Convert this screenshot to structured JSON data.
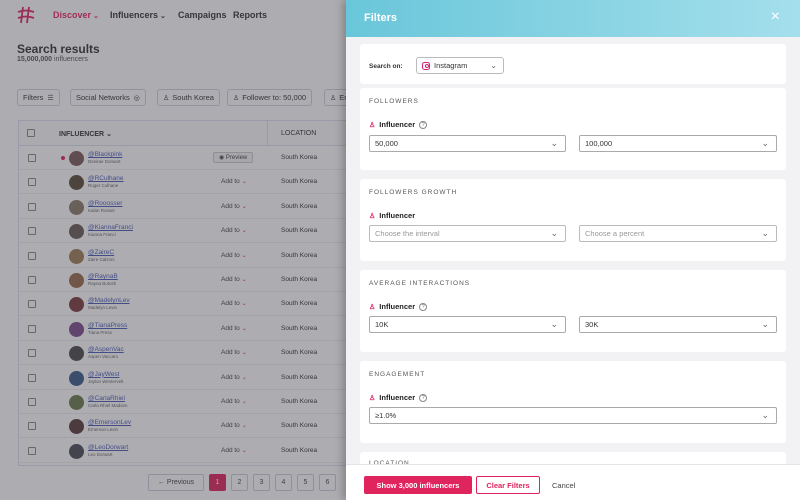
{
  "nav": {
    "items": [
      {
        "label": "Discover",
        "caret": "⌄",
        "active": true
      },
      {
        "label": "Influencers",
        "caret": "⌄",
        "active": false
      },
      {
        "label": "Campaigns",
        "caret": "",
        "active": false
      },
      {
        "label": "Reports",
        "caret": "",
        "active": false
      }
    ]
  },
  "page": {
    "title": "Search results",
    "count": "15,000,000",
    "count_suffix": "influencers"
  },
  "filter_chips": [
    {
      "label": "Filters",
      "icon": "sliders-icon"
    },
    {
      "label": "Social Networks",
      "icon": "instagram-icon"
    },
    {
      "label": "South Korea",
      "icon": "person-icon"
    },
    {
      "label": "Follower to: 50,000",
      "icon": "person-icon"
    },
    {
      "label": "En",
      "icon": "person-icon"
    }
  ],
  "table": {
    "headers": {
      "influencer": "INFLUENCER",
      "location": "LOCATION"
    },
    "preview_label": "Preview",
    "add_label": "Add to",
    "rows": [
      {
        "handle": "@Blackpink",
        "name": "Desirae Dorwart",
        "location": "South Korea",
        "action": "preview",
        "avatar_color": "#7a5a5a"
      },
      {
        "handle": "@RCulhane",
        "name": "Roger Culhane",
        "location": "South Korea",
        "action": "add",
        "avatar_color": "#5a4a3a"
      },
      {
        "handle": "@Rooosser",
        "name": "Kalan Rosser",
        "location": "South Korea",
        "action": "add",
        "avatar_color": "#8a7a6a"
      },
      {
        "handle": "@KiannaFranci",
        "name": "Kianna Franci",
        "location": "South Korea",
        "action": "add",
        "avatar_color": "#6a5a55"
      },
      {
        "handle": "@ZaireC",
        "name": "Zaire Calzoni",
        "location": "South Korea",
        "action": "add",
        "avatar_color": "#a07a55"
      },
      {
        "handle": "@RaynaB",
        "name": "Rayna Botosh",
        "location": "South Korea",
        "action": "add",
        "avatar_color": "#9a6a4a"
      },
      {
        "handle": "@MadelynLev",
        "name": "Madelyn Levin",
        "location": "South Korea",
        "action": "add",
        "avatar_color": "#7a3a3a"
      },
      {
        "handle": "@TianaPress",
        "name": "Tiana Press",
        "location": "South Korea",
        "action": "add",
        "avatar_color": "#7a4a8a"
      },
      {
        "handle": "@AspenVac",
        "name": "Aspen Vaccaro",
        "location": "South Korea",
        "action": "add",
        "avatar_color": "#4a4a4a"
      },
      {
        "handle": "@JayWest",
        "name": "Jaylon Westervelt",
        "location": "South Korea",
        "action": "add",
        "avatar_color": "#3a5a8a"
      },
      {
        "handle": "@CarlaRhiel",
        "name": "Carla Rhiel Madsen",
        "location": "South Korea",
        "action": "add",
        "avatar_color": "#6a7a4a"
      },
      {
        "handle": "@EmersonLev",
        "name": "Emerson Levin",
        "location": "South Korea",
        "action": "add",
        "avatar_color": "#5a3a3a"
      },
      {
        "handle": "@LeoDorwart",
        "name": "Leo Dorwart",
        "location": "South Korea",
        "action": "add",
        "avatar_color": "#4a4a55"
      }
    ]
  },
  "pagination": {
    "previous": "← Previous",
    "pages": [
      "1",
      "2",
      "3",
      "4",
      "5",
      "6"
    ],
    "current": "1"
  },
  "drawer": {
    "title": "Filters",
    "close_icon": "×",
    "search_on": {
      "label": "Search on:",
      "value": "Instagram",
      "icon": "instagram-icon"
    },
    "sections": [
      {
        "title": "FOLLOWERS",
        "label": "Influencer",
        "help": true,
        "from": "50,000",
        "to": "100,000",
        "placeholder": false
      },
      {
        "title": "FOLLOWERS GROWTH",
        "label": "Influencer",
        "help": false,
        "from": "Choose the interval",
        "to": "Choose a percent",
        "placeholder": true
      },
      {
        "title": "AVERAGE INTERACTIONS",
        "label": "Influencer",
        "help": true,
        "from": "10K",
        "to": "30K",
        "placeholder": false
      },
      {
        "title": "ENGAGEMENT",
        "label": "Influencer",
        "help": true,
        "single": "≥1.0%"
      },
      {
        "title": "LOCATION"
      }
    ],
    "footer": {
      "show": "Show 3,000 influencers",
      "clear": "Clear Filters",
      "cancel": "Cancel"
    }
  },
  "colors": {
    "accent": "#e0245e",
    "header_gradient_start": "#69c6d9",
    "header_gradient_end": "#a4dfec"
  }
}
